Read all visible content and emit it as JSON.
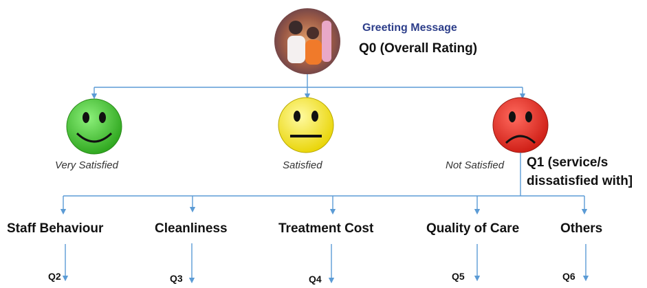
{
  "root": {
    "greeting": "Greeting Message",
    "q0": "Q0 (Overall Rating)"
  },
  "faces": [
    {
      "label": "Very Satisfied",
      "color": "#3fc72a",
      "mood": "smile"
    },
    {
      "label": "Satisfied",
      "color": "#f3e61a",
      "mood": "neutral"
    },
    {
      "label": "Not Satisfied",
      "color": "#e42a23",
      "mood": "frown"
    }
  ],
  "q1": {
    "line1": "Q1 (service/s",
    "line2": "dissatisfied with]"
  },
  "categories": [
    {
      "label": "Staff Behaviour",
      "q": "Q2"
    },
    {
      "label": "Cleanliness",
      "q": "Q3"
    },
    {
      "label": "Treatment Cost",
      "q": "Q4"
    },
    {
      "label": "Quality of Care",
      "q": "Q5"
    },
    {
      "label": "Others",
      "q": "Q6"
    }
  ],
  "colors": {
    "connector": "#5b9bd5"
  }
}
